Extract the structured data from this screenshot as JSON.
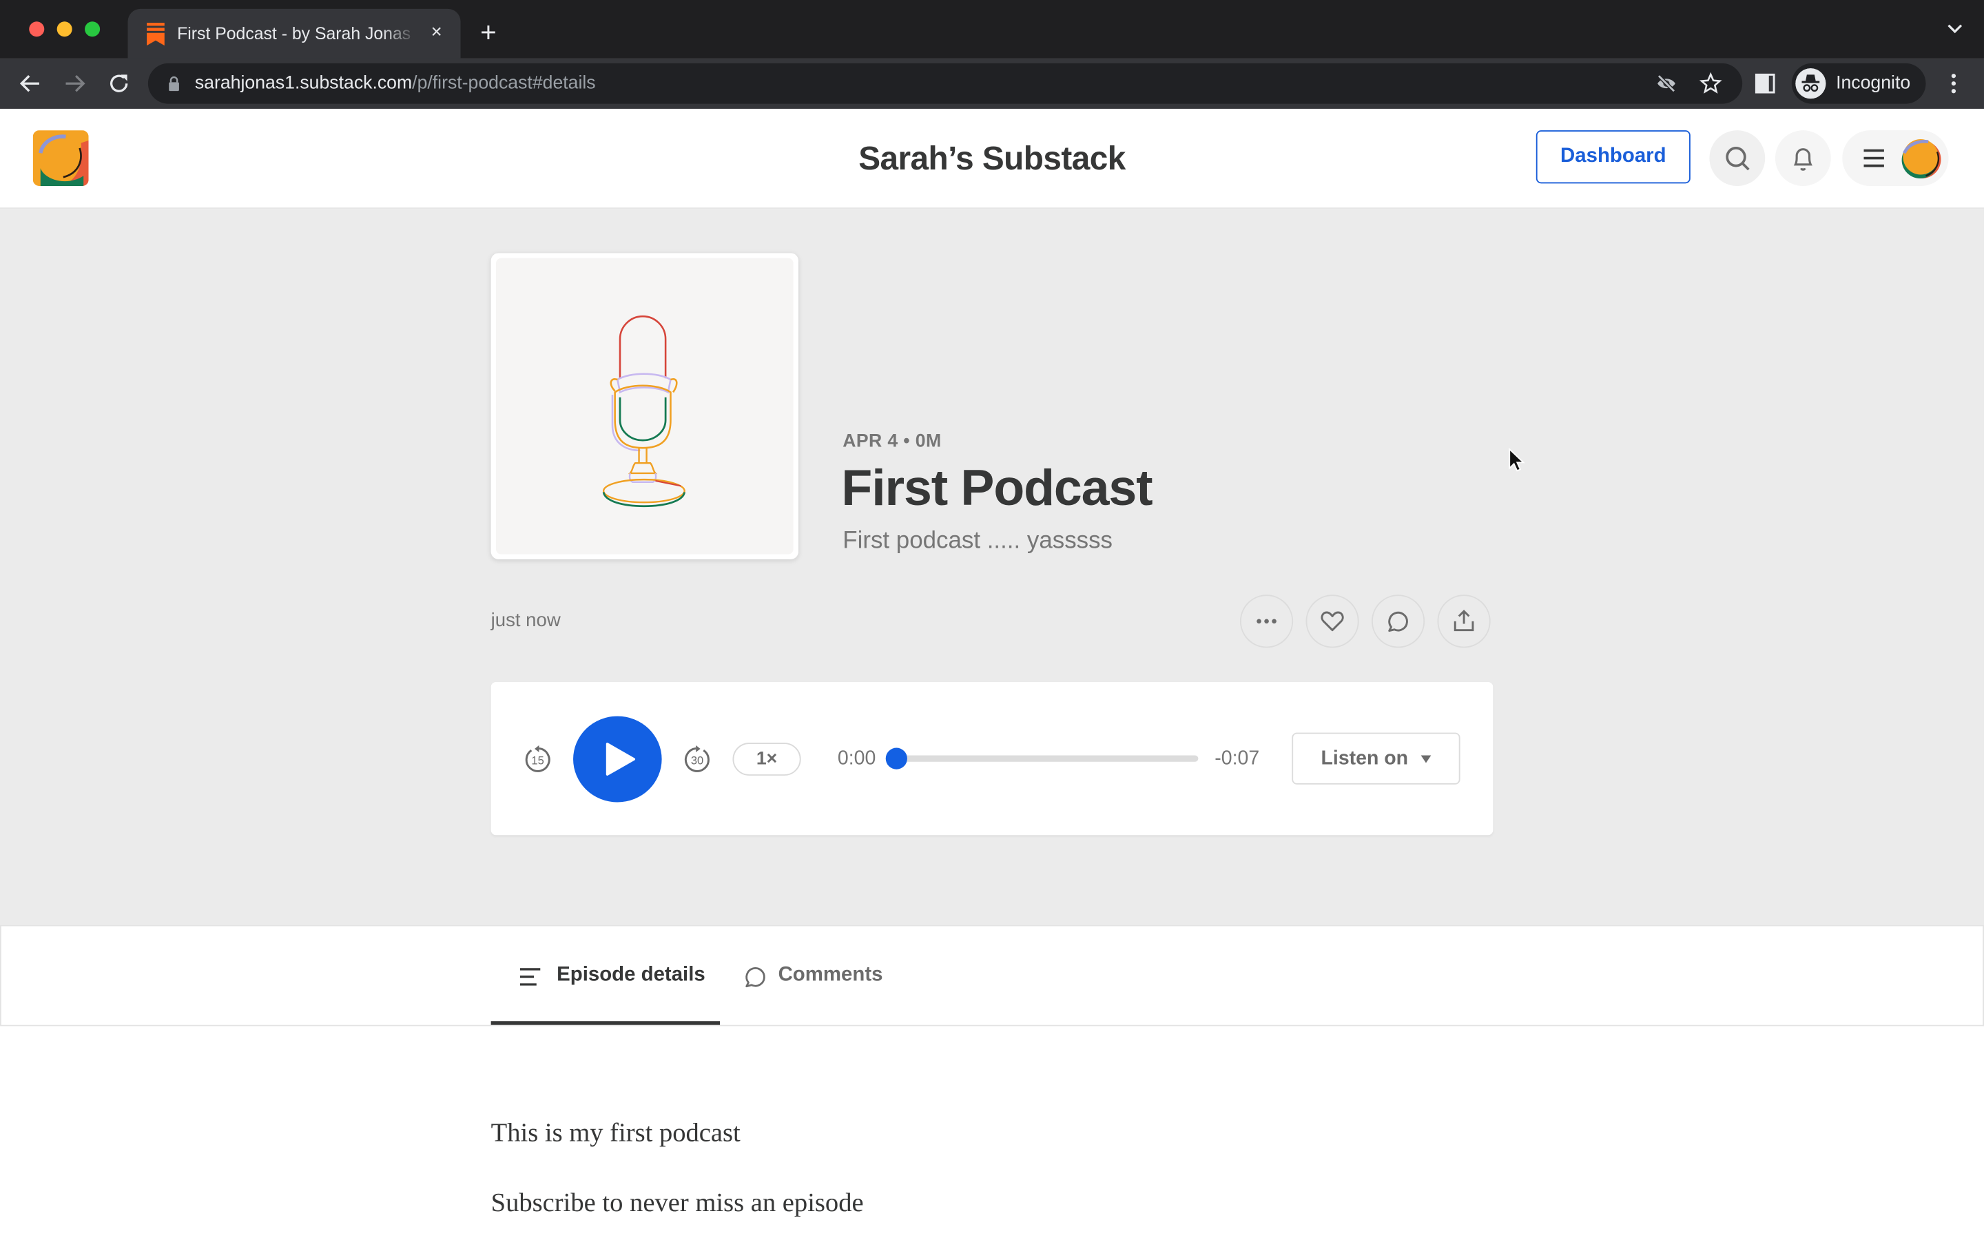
{
  "browser": {
    "tab": {
      "title": "First Podcast - by Sarah Jonas",
      "favicon": "substack-bookmark-icon",
      "close_icon": "×"
    },
    "new_tab_icon": "+",
    "url_host": "sarahjonas1.substack.com",
    "url_path": "/p/first-podcast#details",
    "profile_label": "Incognito",
    "accent": "#ff6719"
  },
  "header": {
    "site_title": "Sarah’s Substack",
    "dashboard_label": "Dashboard",
    "brand_color": "#1a5ed9"
  },
  "episode": {
    "meta": "APR 4 • 0M",
    "title": "First Podcast",
    "subtitle": "First podcast ..... yasssss",
    "posted": "just now"
  },
  "actions": [
    "more-options",
    "like",
    "comment",
    "share"
  ],
  "player": {
    "skip_back_label": "15",
    "skip_forward_label": "30",
    "speed": "1×",
    "current_time": "0:00",
    "remaining_time": "-0:07",
    "progress_fraction": 0,
    "listen_on_label": "Listen on",
    "play_color": "#1360e3"
  },
  "tabs": [
    {
      "label": "Episode details",
      "icon": "list-icon",
      "active": true
    },
    {
      "label": "Comments",
      "icon": "comment-icon",
      "active": false
    }
  ],
  "body": {
    "paragraphs": [
      "This is my first podcast",
      "Subscribe to never miss an episode"
    ]
  }
}
